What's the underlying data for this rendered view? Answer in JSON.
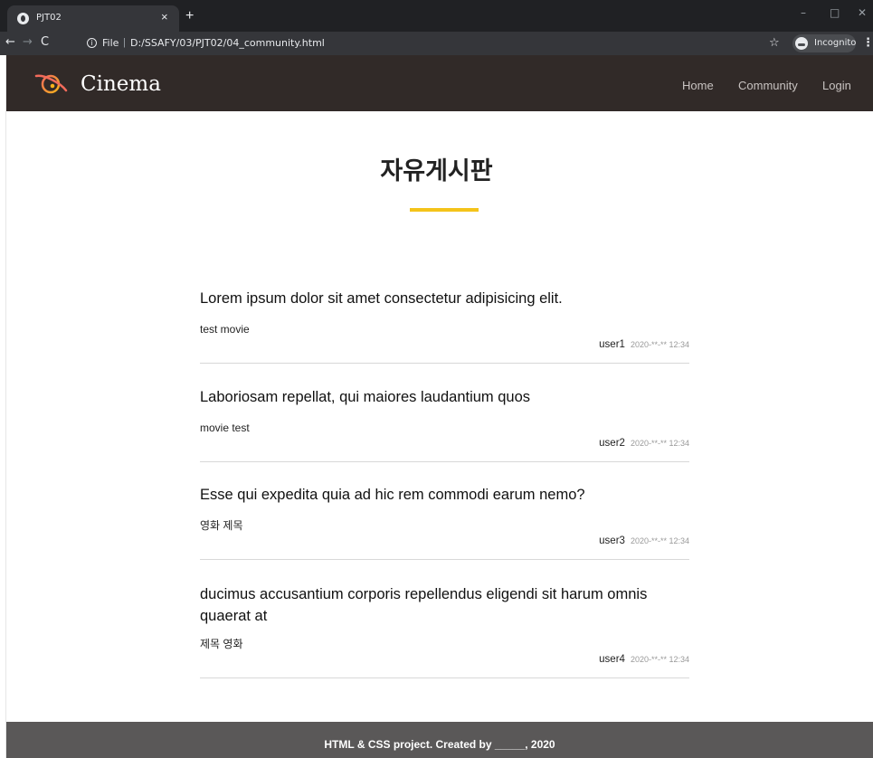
{
  "browser": {
    "tab_title": "PJT02",
    "tab_close": "×",
    "new_tab": "+",
    "url_scheme": "File",
    "url_path": "D:/SSAFY/03/PJT02/04_community.html",
    "incognito_label": "Incognito",
    "colors": {
      "frame": "#202124",
      "toolbar": "#35363a"
    }
  },
  "site": {
    "brand": "Cinema",
    "nav": [
      {
        "label": "Home"
      },
      {
        "label": "Community"
      },
      {
        "label": "Login"
      }
    ],
    "colors": {
      "header": "#312a28",
      "accent": "#f4c31a",
      "footer": "#5a5858"
    }
  },
  "main": {
    "title": "자유게시판",
    "posts": [
      {
        "title": "Lorem ipsum dolor sit amet consectetur adipisicing elit.",
        "body": "test movie",
        "user": "user1",
        "date": "2020-**-** 12:34"
      },
      {
        "title": "Laboriosam repellat, qui maiores laudantium quos",
        "body": "movie test",
        "user": "user2",
        "date": "2020-**-** 12:34"
      },
      {
        "title": "Esse qui expedita quia ad hic rem commodi earum nemo?",
        "body": "영화 제목",
        "user": "user3",
        "date": "2020-**-** 12:34"
      },
      {
        "title": "ducimus accusantium corporis repellendus eligendi sit harum omnis quaerat at",
        "body": "제목 영화",
        "user": "user4",
        "date": "2020-**-** 12:34"
      }
    ]
  },
  "footer": {
    "text": "HTML & CSS project. Created by _____, 2020"
  }
}
